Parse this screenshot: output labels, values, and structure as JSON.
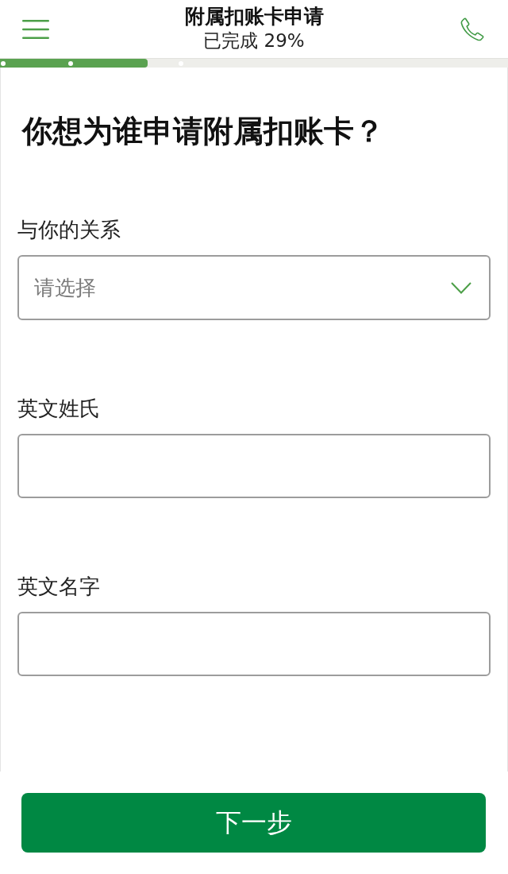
{
  "header": {
    "title": "附属扣账卡申请",
    "subtitle": "已完成 29%"
  },
  "progress": {
    "level": 0.29
  },
  "form": {
    "heading": "你想为谁申请附属扣账卡？",
    "fields": [
      {
        "kind": "select",
        "label": "与你的关系",
        "placeholder": "请选择"
      },
      {
        "kind": "text",
        "label": "英文姓氏"
      },
      {
        "kind": "text",
        "label": "英文名字"
      }
    ]
  },
  "next_button": {
    "label": "下一步"
  }
}
